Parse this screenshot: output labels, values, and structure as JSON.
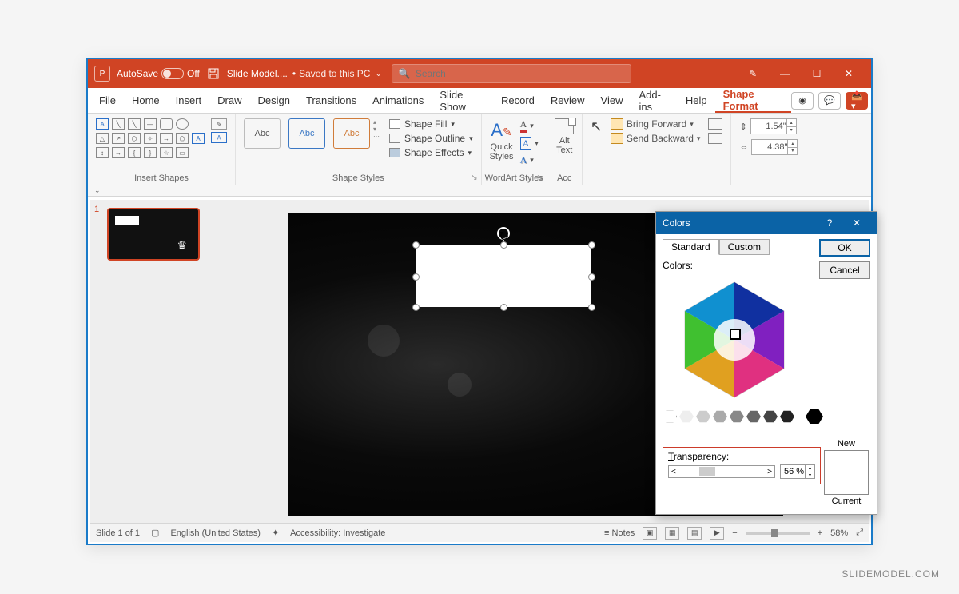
{
  "title": {
    "autosave": "AutoSave",
    "autosave_state": "Off",
    "filename": "Slide Model....",
    "saved": "Saved to this PC",
    "search_placeholder": "Search"
  },
  "tabs": [
    "File",
    "Home",
    "Insert",
    "Draw",
    "Design",
    "Transitions",
    "Animations",
    "Slide Show",
    "Record",
    "Review",
    "View",
    "Add-ins",
    "Help",
    "Shape Format"
  ],
  "active_tab": "Shape Format",
  "ribbon": {
    "insert_shapes": "Insert Shapes",
    "shape_styles": "Shape Styles",
    "wordart_styles": "WordArt Styles",
    "acc": "Acc",
    "abc": "Abc",
    "shape_fill": "Shape Fill",
    "shape_outline": "Shape Outline",
    "shape_effects": "Shape Effects",
    "quick_styles": "Quick\nStyles",
    "alt_text": "Alt\nText",
    "bring_forward": "Bring Forward",
    "send_backward": "Send Backward",
    "height": "1.54\"",
    "width": "4.38\""
  },
  "dialog": {
    "title": "Colors",
    "tab_standard": "Standard",
    "tab_custom": "Custom",
    "ok": "OK",
    "cancel": "Cancel",
    "colors_label": "Colors:",
    "transparency_label": "Transparency:",
    "transparency_value": "56 %",
    "new_label": "New",
    "current_label": "Current"
  },
  "status": {
    "slide": "Slide 1 of 1",
    "lang": "English (United States)",
    "access": "Accessibility: Investigate",
    "notes": "Notes",
    "zoom": "58%"
  },
  "thumb": {
    "num": "1"
  },
  "watermark": "SLIDEMODEL.COM"
}
